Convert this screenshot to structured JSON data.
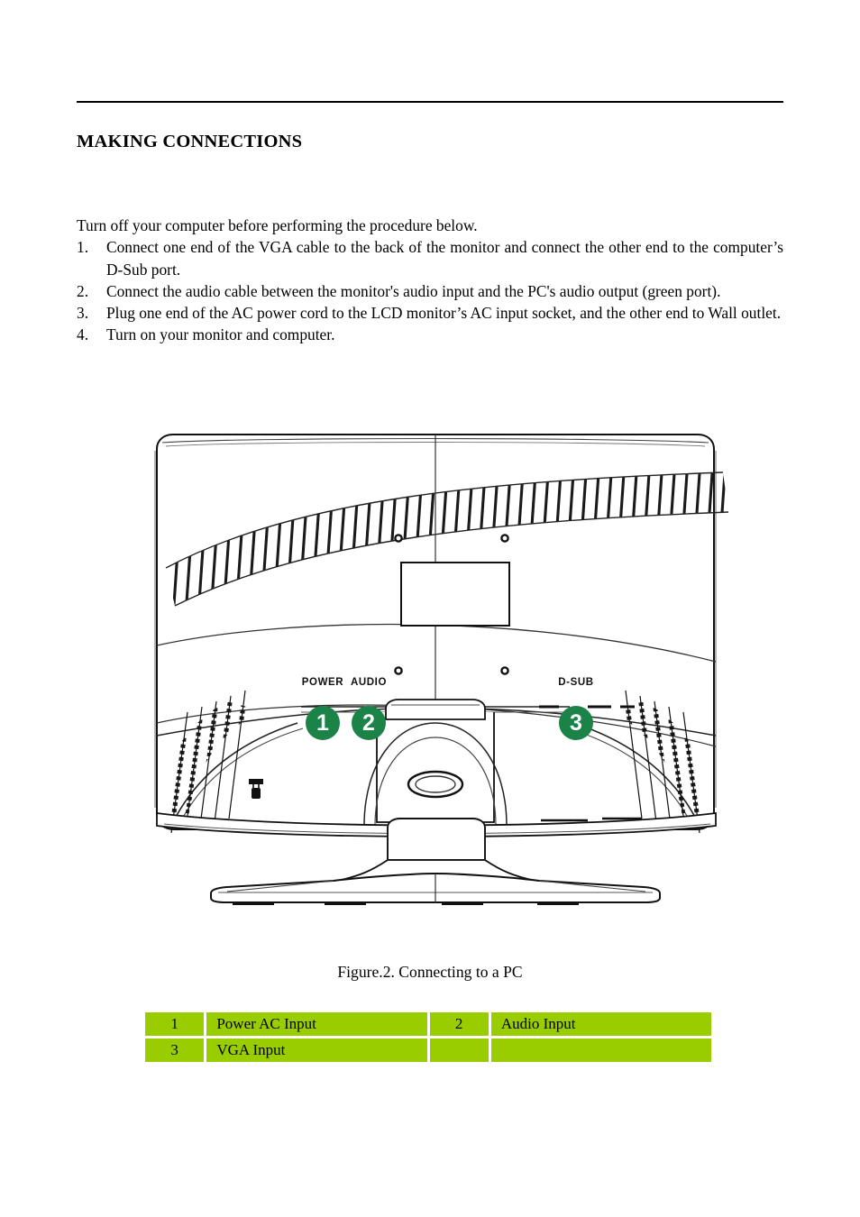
{
  "document": {
    "section_heading": "MAKING CONNECTIONS",
    "intro": "Turn off your computer before performing the procedure below.",
    "steps": [
      {
        "number": "1.",
        "text": "Connect one end of the VGA cable to the back of the monitor and connect the other end to the computer’s D-Sub port."
      },
      {
        "number": "2.",
        "text": "Connect the audio cable between the monitor's audio input and the PC's audio output (green port)."
      },
      {
        "number": "3.",
        "text": "Plug one end of the AC power cord to the LCD monitor’s AC input socket, and the other end to Wall outlet."
      },
      {
        "number": "4.",
        "text": "Turn on your monitor and computer."
      }
    ]
  },
  "figure": {
    "caption": "Figure.2. Connecting to a PC",
    "port_labels": {
      "power": "POWER",
      "audio": "AUDIO",
      "dsub": "D-SUB"
    },
    "callouts": [
      {
        "id": "1",
        "label": "POWER"
      },
      {
        "id": "2",
        "label": "AUDIO"
      },
      {
        "id": "3",
        "label": "D-SUB"
      }
    ]
  },
  "legend_table": {
    "rows": [
      {
        "c1_index": "1",
        "c1_label": "Power AC Input",
        "c2_index": "2",
        "c2_label": "Audio Input"
      },
      {
        "c1_index": "3",
        "c1_label": "VGA Input",
        "c2_index": "",
        "c2_label": ""
      }
    ]
  },
  "colors": {
    "table_green": "#9ACD00",
    "callout_green": "#1B8348",
    "text": "#000000",
    "rule": "#000000"
  }
}
